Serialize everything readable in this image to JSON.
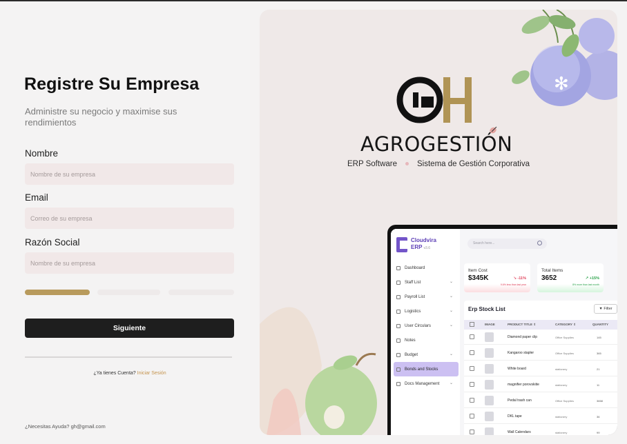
{
  "form": {
    "title": "Registre Su Empresa",
    "subtitle": "Administre su negocio y maximise sus rendimientos",
    "fields": [
      {
        "label": "Nombre",
        "placeholder": "Nombre de su empresa",
        "value": ""
      },
      {
        "label": "Email",
        "placeholder": "Correo de su empresa",
        "value": ""
      },
      {
        "label": "Razón Social",
        "placeholder": "Nombre de su empresa",
        "value": ""
      }
    ],
    "progress": {
      "current_step": 1,
      "total_steps": 3
    },
    "submit_label": "Siguiente",
    "login_prompt": "¿Ya tienes Cuenta?",
    "login_link": "Iniciar Sesión",
    "help": "¿Necesitas Ayuda?  gh@gmail.com"
  },
  "brand": {
    "logo_letters": "GH",
    "name": "AGROGESTIÓN",
    "tagline_left": "ERP Software",
    "tagline_right": "Sistema de Gestión Corporativa",
    "colors": {
      "gold": "#b09455",
      "black": "#111111",
      "accent_dot": "#e7b7bb"
    }
  },
  "mockup": {
    "app_name": "Cloudvira",
    "app_sub": "ERP",
    "version": "v3.6",
    "search_placeholder": "Search here...",
    "nav": [
      {
        "label": "Dashboard",
        "chevron": false,
        "active": false
      },
      {
        "label": "Staff List",
        "chevron": true,
        "active": false
      },
      {
        "label": "Payroll List",
        "chevron": true,
        "active": false
      },
      {
        "label": "Logistics",
        "chevron": true,
        "active": false
      },
      {
        "label": "User Circulars",
        "chevron": true,
        "active": false
      },
      {
        "label": "Notes",
        "chevron": false,
        "active": false
      },
      {
        "label": "Budget",
        "chevron": true,
        "active": false
      },
      {
        "label": "Bonds and Stocks",
        "chevron": false,
        "active": true
      },
      {
        "label": "Docs Management",
        "chevron": true,
        "active": false
      }
    ],
    "cards": [
      {
        "title": "Item Cost",
        "value": "$345K",
        "delta": "↘ -11%",
        "sub": "9.6% less than last year"
      },
      {
        "title": "Total Items",
        "value": "3652",
        "delta": "↗ +15%",
        "sub": "8% more than last month"
      }
    ],
    "table": {
      "title": "Erp Stock List",
      "filter_label": "Filter",
      "headers": [
        "IMAGE",
        "PRODUCT TITLE ⇕",
        "CATEGORY ⇕",
        "QUANTITY"
      ],
      "rows": [
        {
          "name": "Diamond paper clip",
          "category": "Office Supplies",
          "qty": "145"
        },
        {
          "name": "Kangaroo stapler",
          "category": "Office Supplies",
          "qty": "365"
        },
        {
          "name": "White board",
          "category": "stationery",
          "qty": "21"
        },
        {
          "name": "magnifier porovskiite",
          "category": "stationery",
          "qty": "11"
        },
        {
          "name": "Pedal trash can",
          "category": "Office Supplies",
          "qty": "3658"
        },
        {
          "name": "DKL tape",
          "category": "stationery",
          "qty": "36"
        },
        {
          "name": "Wall Calendars",
          "category": "stationery",
          "qty": "99"
        }
      ]
    }
  }
}
